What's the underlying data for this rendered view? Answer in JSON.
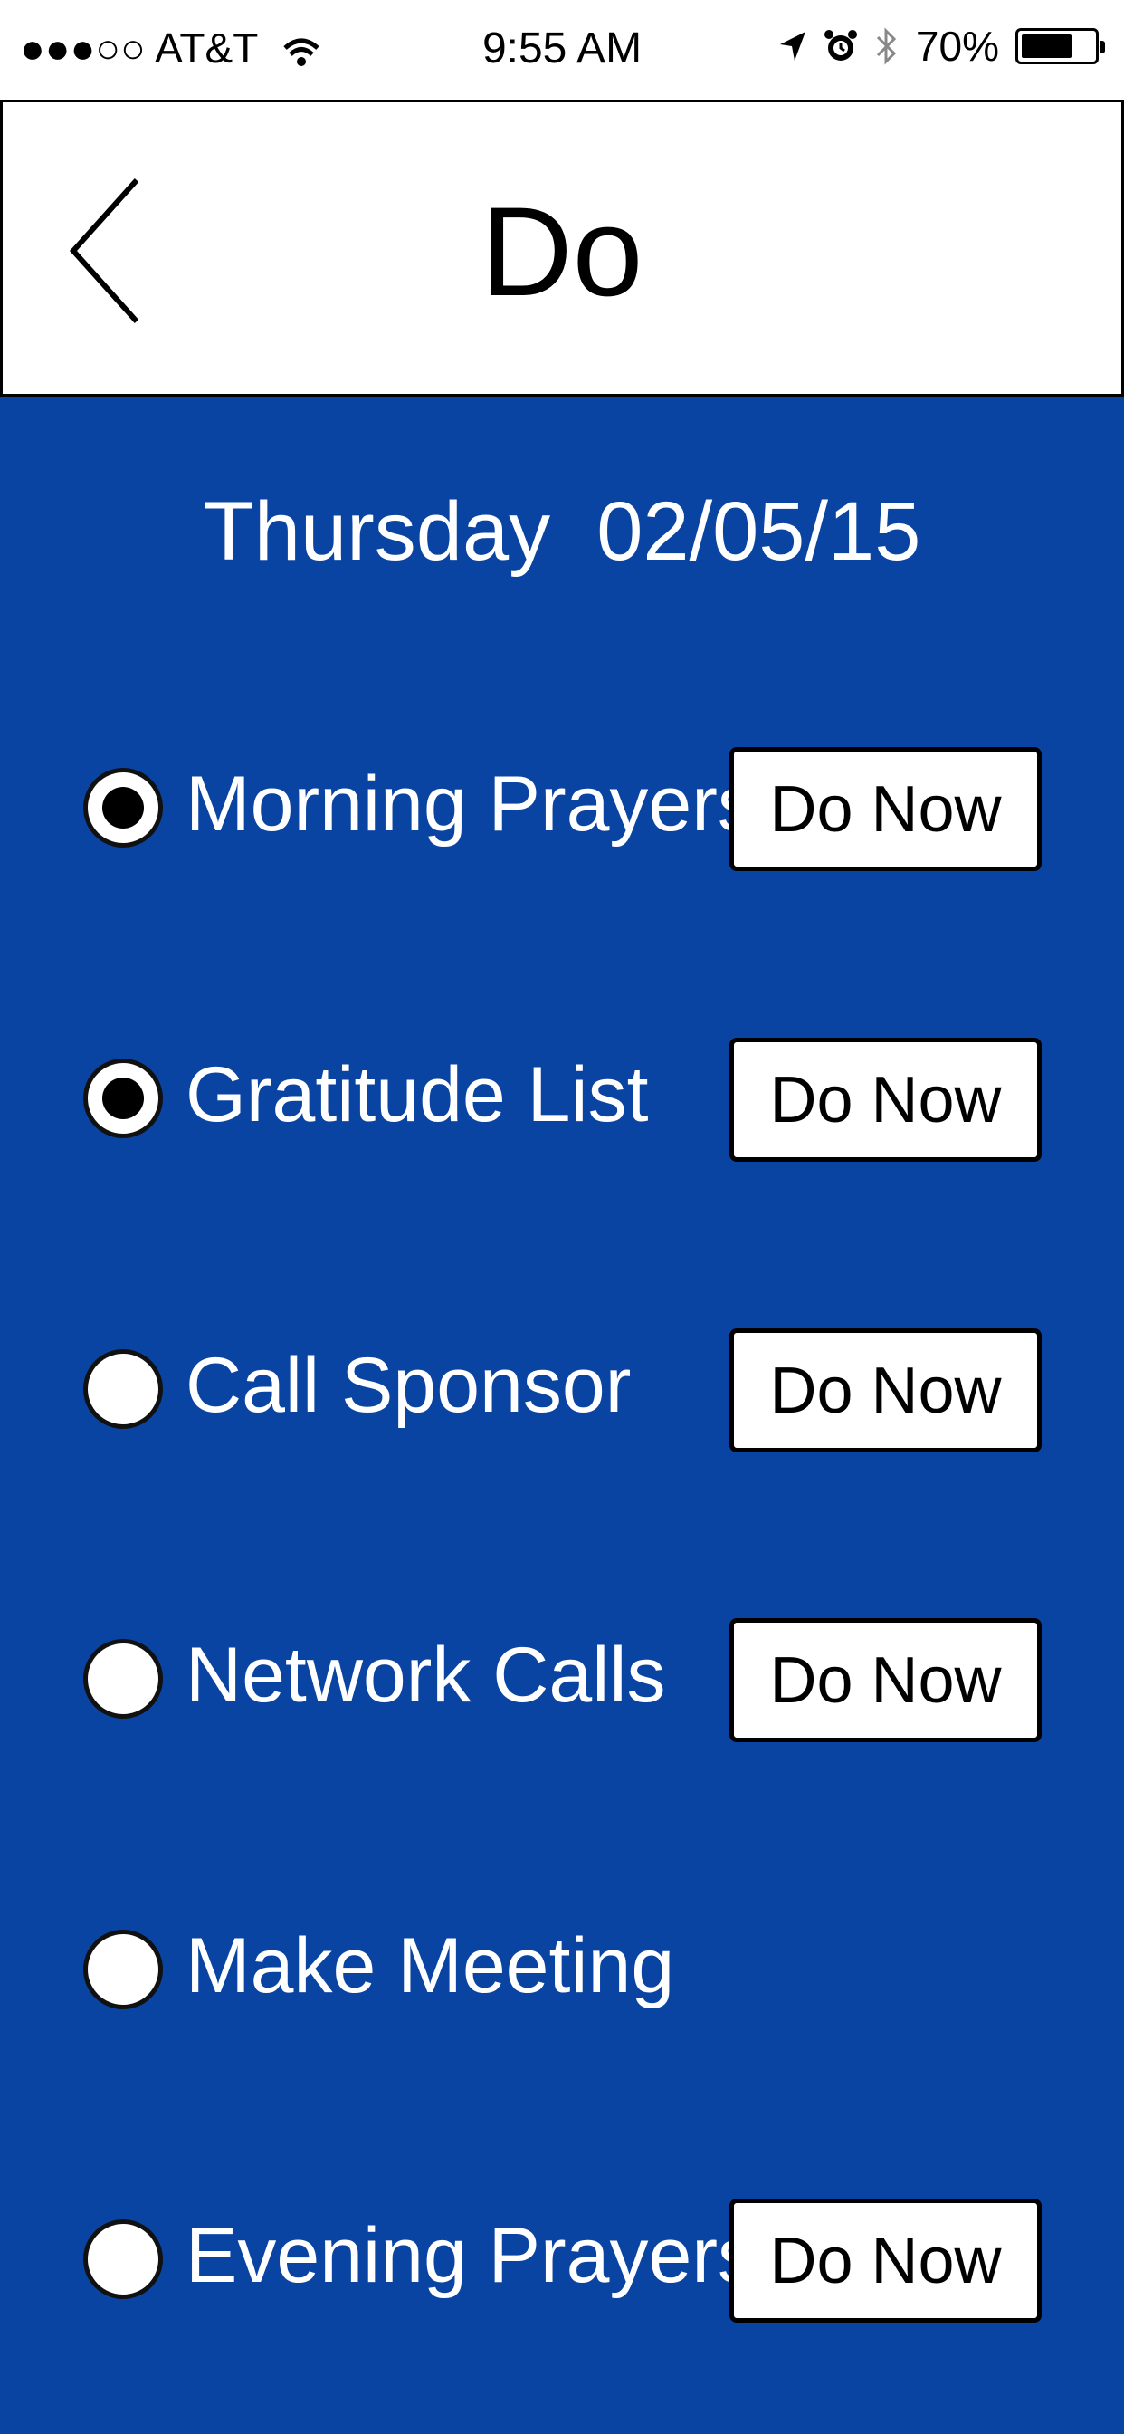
{
  "status_bar": {
    "carrier": "●●●○○ AT&T",
    "time": "9:55 AM",
    "battery_percent": "70%",
    "battery_level": 0.7
  },
  "nav": {
    "title": "Do",
    "back_icon": "chevron-left-icon"
  },
  "date": {
    "day": "Thursday",
    "value": "02/05/15"
  },
  "tasks": [
    {
      "label": "Morning Prayers",
      "checked": true,
      "button": "Do Now"
    },
    {
      "label": "Gratitude List",
      "checked": true,
      "button": "Do Now"
    },
    {
      "label": "Call Sponsor",
      "checked": false,
      "button": "Do Now"
    },
    {
      "label": "Network Calls",
      "checked": false,
      "button": "Do Now"
    },
    {
      "label": "Make Meeting",
      "checked": false,
      "button": ""
    },
    {
      "label": "Evening Prayers",
      "checked": false,
      "button": "Do Now"
    }
  ],
  "colors": {
    "background": "#0a44a3",
    "text": "#ffffff"
  }
}
